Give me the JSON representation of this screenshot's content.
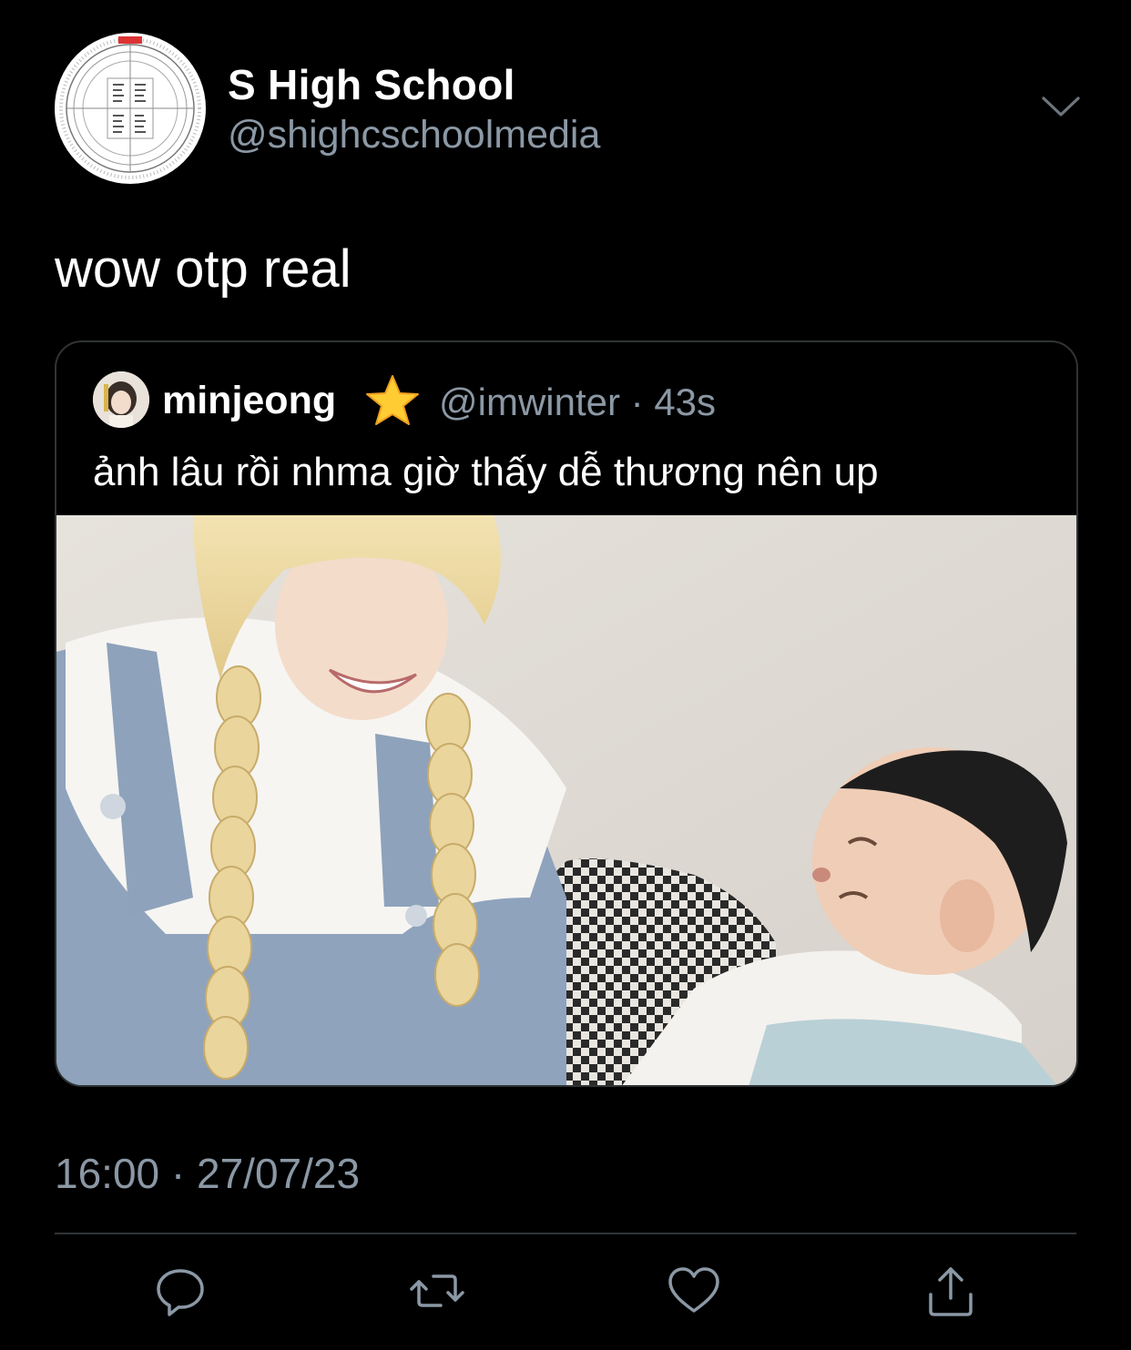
{
  "tweet": {
    "author": {
      "display_name": "S High School",
      "handle": "@shighcschoolmedia",
      "avatar_icon": "circular-chart-avatar"
    },
    "text": "wow otp real",
    "timestamp": "16:00 · 27/07/23",
    "more_icon": "chevron-down-icon"
  },
  "quoted_tweet": {
    "author": {
      "display_name": "minjeong",
      "badge_icon": "star-emoji",
      "handle": "@imwinter",
      "age": "43s"
    },
    "text": "ảnh lâu rồi nhma giờ thấy dễ thương nên up",
    "media_icon": "photo-media"
  },
  "actions": [
    {
      "name": "reply",
      "icon": "reply-icon"
    },
    {
      "name": "retweet",
      "icon": "retweet-icon"
    },
    {
      "name": "like",
      "icon": "heart-icon"
    },
    {
      "name": "share",
      "icon": "share-icon"
    }
  ],
  "colors": {
    "background": "#000000",
    "primary_text": "#ffffff",
    "secondary_text": "#8b98a5",
    "border": "#2f3336",
    "star": "#ffcc33"
  }
}
